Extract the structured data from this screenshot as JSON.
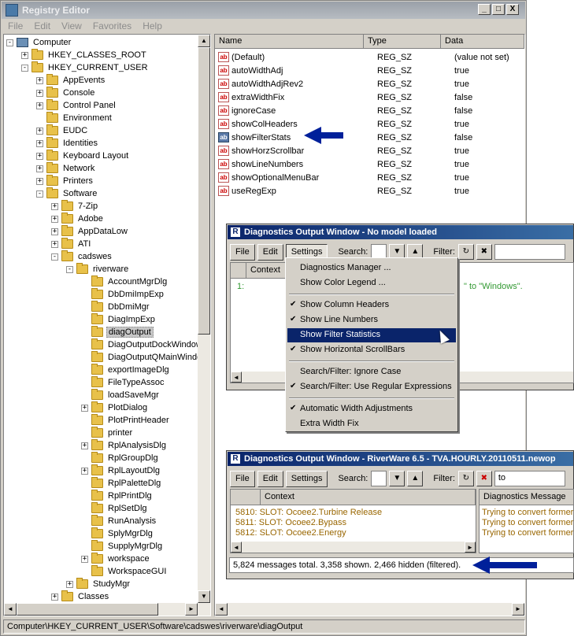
{
  "regedit": {
    "title": "Registry Editor",
    "window_buttons": [
      "_",
      "□",
      "X"
    ],
    "menu": [
      "File",
      "Edit",
      "View",
      "Favorites",
      "Help"
    ],
    "tree": [
      {
        "label": "Computer",
        "icon": "computer-icon",
        "expander": "-",
        "level": 0
      },
      {
        "label": "HKEY_CLASSES_ROOT",
        "icon": "folder-icon",
        "expander": "+",
        "level": 1
      },
      {
        "label": "HKEY_CURRENT_USER",
        "icon": "folder-icon",
        "expander": "-",
        "level": 1
      },
      {
        "label": "AppEvents",
        "icon": "folder-icon",
        "expander": "+",
        "level": 2
      },
      {
        "label": "Console",
        "icon": "folder-icon",
        "expander": "+",
        "level": 2
      },
      {
        "label": "Control Panel",
        "icon": "folder-icon",
        "expander": "+",
        "level": 2
      },
      {
        "label": "Environment",
        "icon": "folder-icon",
        "expander": "",
        "level": 2
      },
      {
        "label": "EUDC",
        "icon": "folder-icon",
        "expander": "+",
        "level": 2
      },
      {
        "label": "Identities",
        "icon": "folder-icon",
        "expander": "+",
        "level": 2
      },
      {
        "label": "Keyboard Layout",
        "icon": "folder-icon",
        "expander": "+",
        "level": 2
      },
      {
        "label": "Network",
        "icon": "folder-icon",
        "expander": "+",
        "level": 2
      },
      {
        "label": "Printers",
        "icon": "folder-icon",
        "expander": "+",
        "level": 2
      },
      {
        "label": "Software",
        "icon": "folder-icon",
        "expander": "-",
        "level": 2
      },
      {
        "label": "7-Zip",
        "icon": "folder-icon",
        "expander": "+",
        "level": 3
      },
      {
        "label": "Adobe",
        "icon": "folder-icon",
        "expander": "+",
        "level": 3
      },
      {
        "label": "AppDataLow",
        "icon": "folder-icon",
        "expander": "+",
        "level": 3
      },
      {
        "label": "ATI",
        "icon": "folder-icon",
        "expander": "+",
        "level": 3
      },
      {
        "label": "cadswes",
        "icon": "folder-icon",
        "expander": "-",
        "level": 3
      },
      {
        "label": "riverware",
        "icon": "folder-icon",
        "expander": "-",
        "level": 4
      },
      {
        "label": "AccountMgrDlg",
        "icon": "folder-icon",
        "expander": "",
        "level": 5
      },
      {
        "label": "DbDmiImpExp",
        "icon": "folder-icon",
        "expander": "",
        "level": 5
      },
      {
        "label": "DbDmiMgr",
        "icon": "folder-icon",
        "expander": "",
        "level": 5
      },
      {
        "label": "DiagImpExp",
        "icon": "folder-icon",
        "expander": "",
        "level": 5
      },
      {
        "label": "diagOutput",
        "icon": "folder-icon",
        "expander": "",
        "level": 5,
        "selected": true
      },
      {
        "label": "DiagOutputDockWindow",
        "icon": "folder-icon",
        "expander": "",
        "level": 5
      },
      {
        "label": "DiagOutputQMainWindow",
        "icon": "folder-icon",
        "expander": "",
        "level": 5
      },
      {
        "label": "exportImageDlg",
        "icon": "folder-icon",
        "expander": "",
        "level": 5
      },
      {
        "label": "FileTypeAssoc",
        "icon": "folder-icon",
        "expander": "",
        "level": 5
      },
      {
        "label": "loadSaveMgr",
        "icon": "folder-icon",
        "expander": "",
        "level": 5
      },
      {
        "label": "PlotDialog",
        "icon": "folder-icon",
        "expander": "+",
        "level": 5
      },
      {
        "label": "PlotPrintHeader",
        "icon": "folder-icon",
        "expander": "",
        "level": 5
      },
      {
        "label": "printer",
        "icon": "folder-icon",
        "expander": "",
        "level": 5
      },
      {
        "label": "RplAnalysisDlg",
        "icon": "folder-icon",
        "expander": "+",
        "level": 5
      },
      {
        "label": "RplGroupDlg",
        "icon": "folder-icon",
        "expander": "",
        "level": 5
      },
      {
        "label": "RplLayoutDlg",
        "icon": "folder-icon",
        "expander": "+",
        "level": 5
      },
      {
        "label": "RplPaletteDlg",
        "icon": "folder-icon",
        "expander": "",
        "level": 5
      },
      {
        "label": "RplPrintDlg",
        "icon": "folder-icon",
        "expander": "",
        "level": 5
      },
      {
        "label": "RplSetDlg",
        "icon": "folder-icon",
        "expander": "",
        "level": 5
      },
      {
        "label": "RunAnalysis",
        "icon": "folder-icon",
        "expander": "",
        "level": 5
      },
      {
        "label": "SplyMgrDlg",
        "icon": "folder-icon",
        "expander": "",
        "level": 5
      },
      {
        "label": "SupplyMgrDlg",
        "icon": "folder-icon",
        "expander": "",
        "level": 5
      },
      {
        "label": "workspace",
        "icon": "folder-icon",
        "expander": "+",
        "level": 5
      },
      {
        "label": "WorkspaceGUI",
        "icon": "folder-icon",
        "expander": "",
        "level": 5
      },
      {
        "label": "StudyMgr",
        "icon": "folder-icon",
        "expander": "+",
        "level": 4
      },
      {
        "label": "Classes",
        "icon": "folder-icon",
        "expander": "+",
        "level": 3
      }
    ],
    "columns": [
      "Name",
      "Type",
      "Data"
    ],
    "values": [
      {
        "name": "(Default)",
        "type": "REG_SZ",
        "data": "(value not set)",
        "icon": "string-value-icon"
      },
      {
        "name": "autoWidthAdj",
        "type": "REG_SZ",
        "data": "true",
        "icon": "string-value-icon"
      },
      {
        "name": "autoWidthAdjRev2",
        "type": "REG_SZ",
        "data": "true",
        "icon": "string-value-icon"
      },
      {
        "name": "extraWidthFix",
        "type": "REG_SZ",
        "data": "false",
        "icon": "string-value-icon"
      },
      {
        "name": "ignoreCase",
        "type": "REG_SZ",
        "data": "false",
        "icon": "string-value-icon"
      },
      {
        "name": "showColHeaders",
        "type": "REG_SZ",
        "data": "true",
        "icon": "string-value-icon"
      },
      {
        "name": "showFilterStats",
        "type": "REG_SZ",
        "data": "false",
        "icon": "string-value-icon",
        "highlighted": true
      },
      {
        "name": "showHorzScrollbar",
        "type": "REG_SZ",
        "data": "true",
        "icon": "string-value-icon"
      },
      {
        "name": "showLineNumbers",
        "type": "REG_SZ",
        "data": "true",
        "icon": "string-value-icon"
      },
      {
        "name": "showOptionalMenuBar",
        "type": "REG_SZ",
        "data": "true",
        "icon": "string-value-icon"
      },
      {
        "name": "useRegExp",
        "type": "REG_SZ",
        "data": "true",
        "icon": "string-value-icon"
      }
    ],
    "status_path": "Computer\\HKEY_CURRENT_USER\\Software\\cadswes\\riverware\\diagOutput"
  },
  "diag1": {
    "title": "Diagnostics Output Window - No model loaded",
    "buttons": [
      "File",
      "Edit",
      "Settings"
    ],
    "search_label": "Search:",
    "filter_label": "Filter:",
    "col_context": "Context",
    "line_number": "1:",
    "line_fragment": "\" to \"Windows\"."
  },
  "settings_menu": {
    "items": [
      {
        "label": "Diagnostics Manager ...",
        "checked": false
      },
      {
        "label": "Show Color Legend ...",
        "checked": false
      },
      {
        "sep": true
      },
      {
        "label": "Show Column Headers",
        "checked": true
      },
      {
        "label": "Show Line Numbers",
        "checked": true
      },
      {
        "label": "Show Filter Statistics",
        "checked": false,
        "highlighted": true
      },
      {
        "label": "Show Horizontal ScrollBars",
        "checked": true
      },
      {
        "sep": true
      },
      {
        "label": "Search/Filter: Ignore Case",
        "checked": false
      },
      {
        "label": "Search/Filter: Use Regular Expressions",
        "checked": true
      },
      {
        "sep": true
      },
      {
        "label": "Automatic Width Adjustments",
        "checked": true
      },
      {
        "label": "Extra Width Fix",
        "checked": false
      }
    ]
  },
  "diag2": {
    "title": "Diagnostics Output Window - RiverWare 6.5 - TVA.HOURLY.20110511.newop",
    "buttons": [
      "File",
      "Edit",
      "Settings"
    ],
    "search_label": "Search:",
    "filter_label": "Filter:",
    "filter_value": "to",
    "col_context": "Context",
    "col_message": "Diagnostics Message",
    "rows": [
      {
        "context": "5810:  SLOT: Ocoee2.Turbine Release",
        "message": "Trying to convert former"
      },
      {
        "context": "5811:  SLOT: Ocoee2.Bypass",
        "message": "Trying to convert former"
      },
      {
        "context": "5812:  SLOT: Ocoee2.Energy",
        "message": "Trying to convert former"
      }
    ],
    "status": "5,824 messages total. 3,358 shown. 2,466 hidden (filtered)."
  },
  "colors": {
    "arrow": "#00209a",
    "title_active": "#0a246a",
    "menu_highlight": "#0a246a",
    "log_text": "#996600"
  }
}
